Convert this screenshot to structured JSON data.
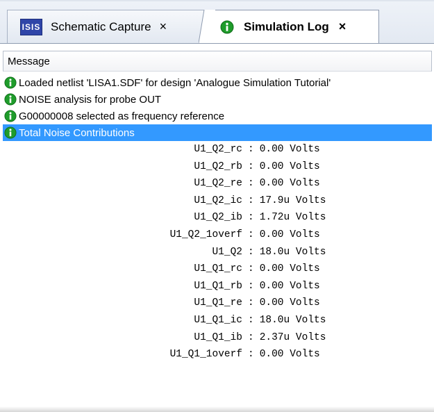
{
  "tabs": {
    "schematic": {
      "icon_text": "ISIS",
      "label": "Schematic Capture",
      "close": "×"
    },
    "log": {
      "label": "Simulation Log",
      "close": "×"
    }
  },
  "log": {
    "column_header": "Message",
    "messages": [
      "Loaded netlist 'LISA1.SDF' for design 'Analogue Simulation Tutorial'",
      "NOISE analysis for probe OUT",
      "G00000008 selected as frequency reference",
      "Total Noise Contributions"
    ],
    "contributions": [
      {
        "name": "U1_Q2_rc",
        "value": "0.00 Volts"
      },
      {
        "name": "U1_Q2_rb",
        "value": "0.00 Volts"
      },
      {
        "name": "U1_Q2_re",
        "value": "0.00 Volts"
      },
      {
        "name": "U1_Q2_ic",
        "value": "17.9u Volts"
      },
      {
        "name": "U1_Q2_ib",
        "value": "1.72u Volts"
      },
      {
        "name": "U1_Q2_1overf",
        "value": "0.00 Volts"
      },
      {
        "name": "U1_Q2",
        "value": "18.0u Volts"
      },
      {
        "name": "U1_Q1_rc",
        "value": "0.00 Volts"
      },
      {
        "name": "U1_Q1_rb",
        "value": "0.00 Volts"
      },
      {
        "name": "U1_Q1_re",
        "value": "0.00 Volts"
      },
      {
        "name": "U1_Q1_ic",
        "value": "18.0u Volts"
      },
      {
        "name": "U1_Q1_ib",
        "value": "2.37u Volts"
      },
      {
        "name": "U1_Q1_1overf",
        "value": "0.00 Volts"
      }
    ],
    "separator": ":"
  },
  "colors": {
    "selection": "#3399ff",
    "info_icon": "#1f9c2b",
    "isis_icon": "#2f45a8"
  }
}
